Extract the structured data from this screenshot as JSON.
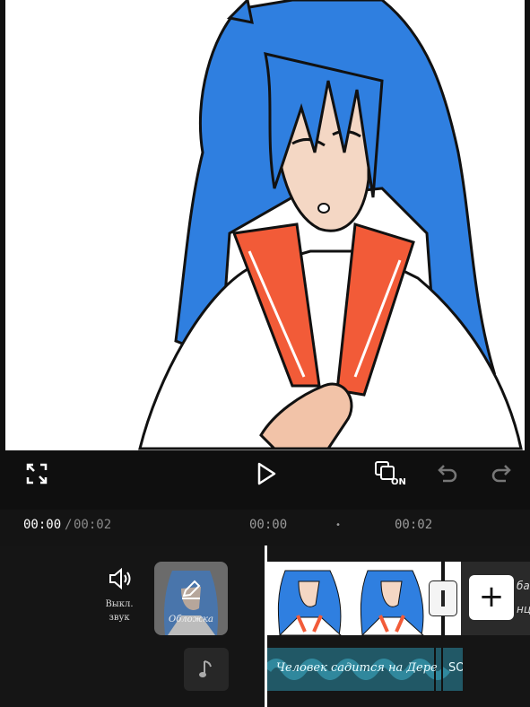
{
  "controls": {
    "fullscreen_icon": "expand-icon",
    "play_icon": "play-icon",
    "captions_toggle_icon": "captions-on-icon",
    "captions_on_label": "ON",
    "undo_icon": "undo-icon",
    "redo_icon": "redo-icon"
  },
  "time": {
    "current": "00:00",
    "separator": "/",
    "total": "00:02",
    "ruler_start": "00:00",
    "ruler_dot": "•",
    "ruler_end": "00:02"
  },
  "timeline": {
    "mute_label_line1": "Выкл.",
    "mute_label_line2": "звук",
    "cover_label": "Обложка",
    "audio_track_text": "Человек садится на Дере",
    "audio_track_text2": "SO",
    "add_clip_symbol": "+",
    "next_clip_text_top": "ба",
    "next_clip_text_bottom": "нц"
  },
  "colors": {
    "accent": "#ffffff",
    "audio_track": "#215866",
    "hair": "#2f7fe0",
    "collar": "#f25b38"
  }
}
